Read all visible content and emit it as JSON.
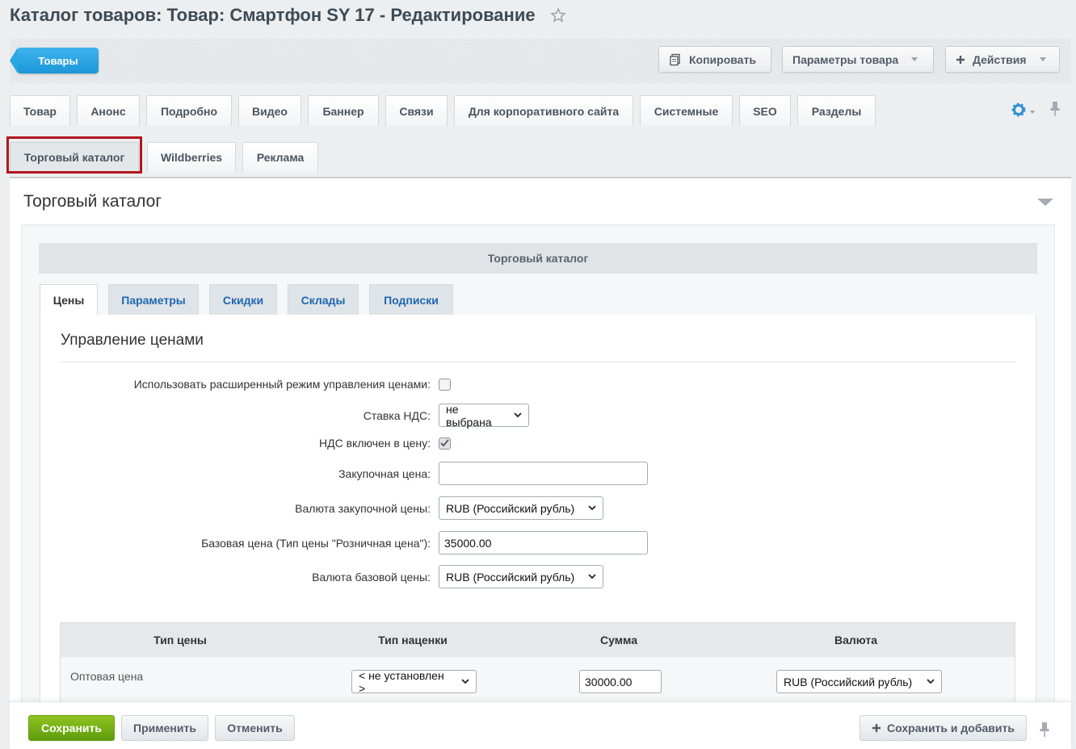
{
  "page": {
    "title": "Каталог товаров: Товар: Смартфон SY 17 - Редактирование"
  },
  "toolbar": {
    "back_label": "Товары",
    "copy_label": "Копировать",
    "params_label": "Параметры товара",
    "actions_label": "Действия"
  },
  "main_tabs": {
    "row1": [
      "Товар",
      "Анонс",
      "Подробно",
      "Видео",
      "Баннер",
      "Связи",
      "Для корпоративного сайта",
      "Системные",
      "SEO",
      "Разделы"
    ],
    "row2": [
      "Торговый каталог",
      "Wildberries",
      "Реклама"
    ]
  },
  "panel": {
    "title": "Торговый каталог",
    "inner_header": "Торговый каталог",
    "sub_tabs": [
      "Цены",
      "Параметры",
      "Скидки",
      "Склады",
      "Подписки"
    ],
    "section_heading": "Управление ценами"
  },
  "form": {
    "extended_mode_label": "Использовать расширенный режим управления ценами:",
    "extended_mode_checked": false,
    "vat_rate_label": "Ставка НДС:",
    "vat_rate_value": "не выбрана",
    "vat_included_label": "НДС включен в цену:",
    "vat_included_checked": true,
    "purchase_price_label": "Закупочная цена:",
    "purchase_price_value": "",
    "purchase_currency_label": "Валюта закупочной цены:",
    "purchase_currency_value": "RUB (Российский рубль)",
    "base_price_label": "Базовая цена (Тип цены \"Розничная цена\"):",
    "base_price_value": "35000.00",
    "base_currency_label": "Валюта базовой цены:",
    "base_currency_value": "RUB (Российский рубль)"
  },
  "price_table": {
    "headers": [
      "Тип цены",
      "Тип наценки",
      "Сумма",
      "Валюта"
    ],
    "rows": [
      {
        "type": "Оптовая цена",
        "markup": "< не установлен >",
        "sum": "30000.00",
        "currency": "RUB (Российский рубль)"
      }
    ]
  },
  "bottom_bar": {
    "save_label": "Сохранить",
    "apply_label": "Применить",
    "cancel_label": "Отменить",
    "save_add_label": "Сохранить и добавить"
  },
  "colors": {
    "accent_blue": "#1c97d9",
    "save_green": "#6fae12",
    "highlight_red": "#b0161c"
  }
}
